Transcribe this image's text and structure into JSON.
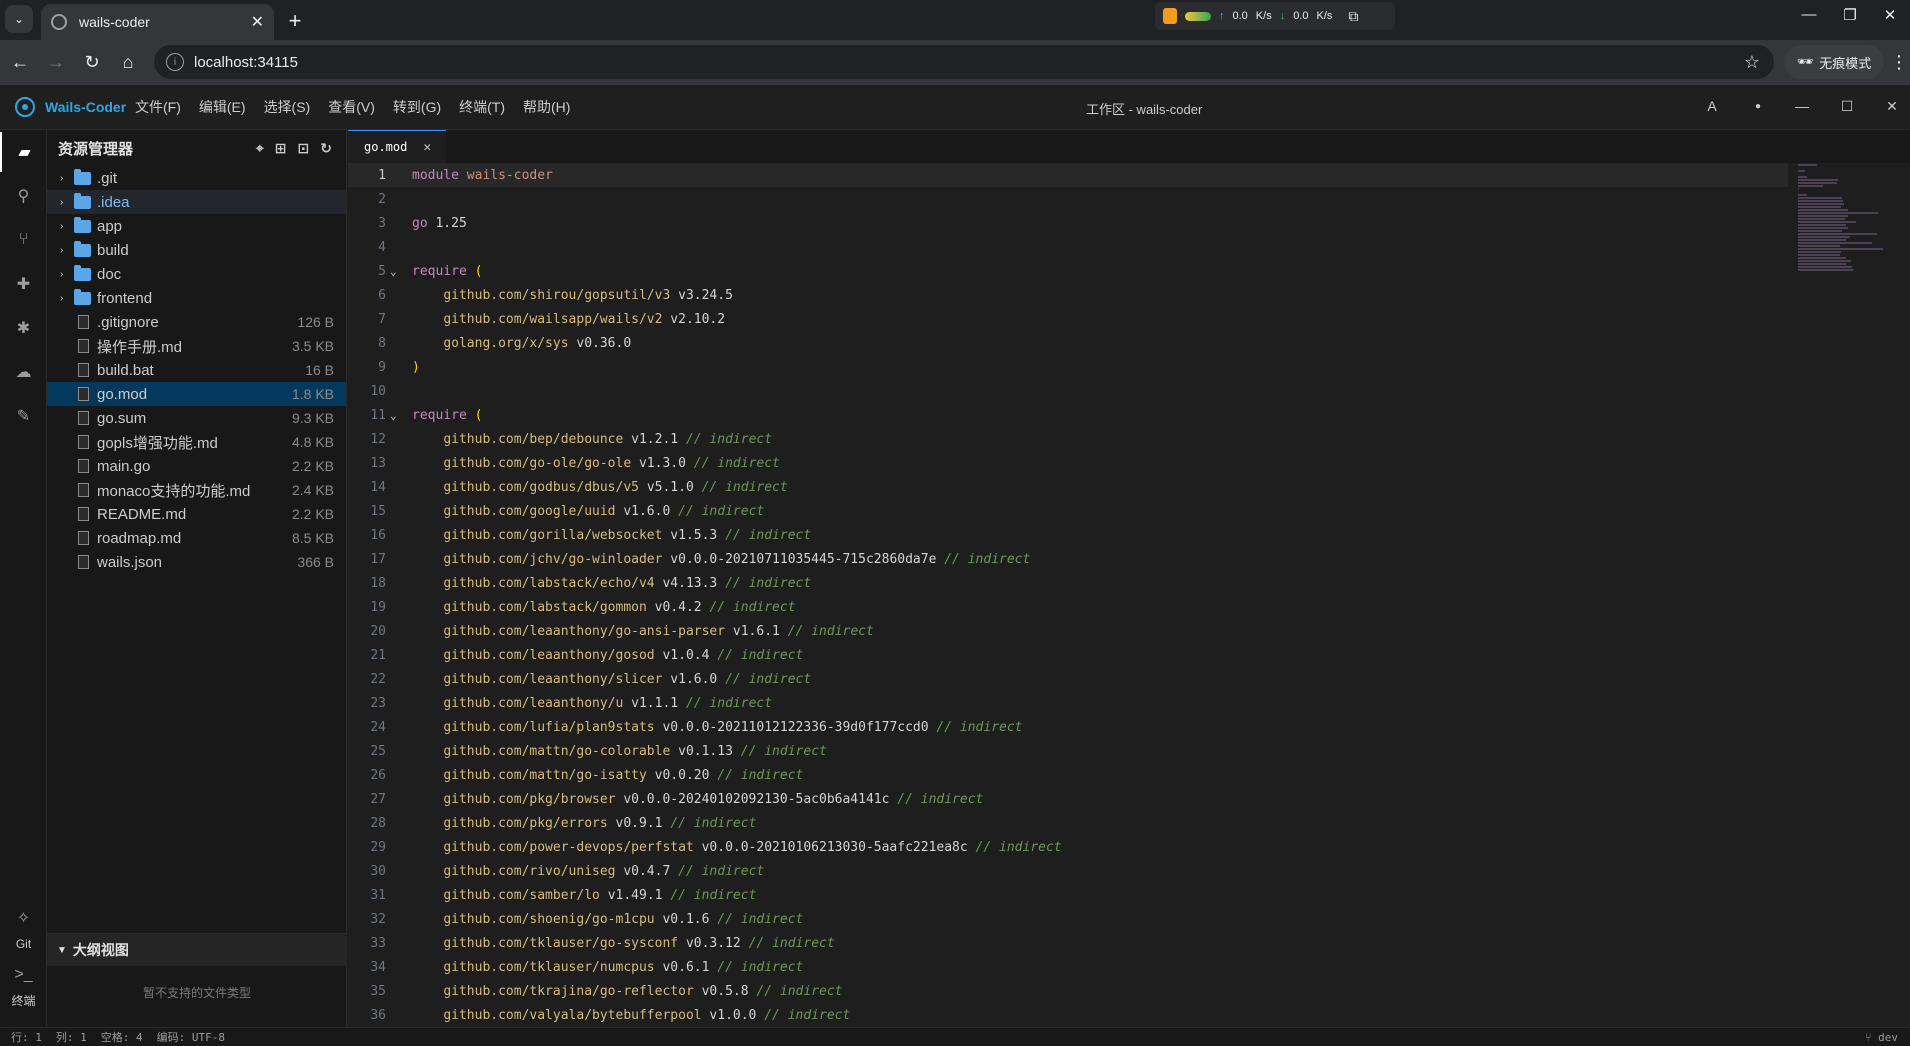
{
  "browser": {
    "tab_title": "wails-coder",
    "url": "localhost:34115",
    "incognito_label": "无痕模式",
    "net_up": "0.0",
    "net_down": "0.0",
    "net_unit": "K/s"
  },
  "app": {
    "title": "Wails-Coder",
    "menus": [
      "文件(F)",
      "编辑(E)",
      "选择(S)",
      "查看(V)",
      "转到(G)",
      "终端(T)",
      "帮助(H)"
    ],
    "workspace_title": "工作区 - wails-coder",
    "font_button": "A"
  },
  "activity": {
    "git_label": "Git",
    "terminal_label": "终端"
  },
  "explorer": {
    "title": "资源管理器",
    "items": [
      {
        "name": ".git",
        "type": "folder",
        "size": ""
      },
      {
        "name": ".idea",
        "type": "folder",
        "size": ""
      },
      {
        "name": "app",
        "type": "folder",
        "size": ""
      },
      {
        "name": "build",
        "type": "folder",
        "size": ""
      },
      {
        "name": "doc",
        "type": "folder",
        "size": ""
      },
      {
        "name": "frontend",
        "type": "folder",
        "size": ""
      },
      {
        "name": ".gitignore",
        "type": "file",
        "size": "126 B"
      },
      {
        "name": "操作手册.md",
        "type": "file",
        "size": "3.5 KB"
      },
      {
        "name": "build.bat",
        "type": "file",
        "size": "16 B"
      },
      {
        "name": "go.mod",
        "type": "file",
        "size": "1.8 KB"
      },
      {
        "name": "go.sum",
        "type": "file",
        "size": "9.3 KB"
      },
      {
        "name": "gopls增强功能.md",
        "type": "file",
        "size": "4.8 KB"
      },
      {
        "name": "main.go",
        "type": "file",
        "size": "2.2 KB"
      },
      {
        "name": "monaco支持的功能.md",
        "type": "file",
        "size": "2.4 KB"
      },
      {
        "name": "README.md",
        "type": "file",
        "size": "2.2 KB"
      },
      {
        "name": "roadmap.md",
        "type": "file",
        "size": "8.5 KB"
      },
      {
        "name": "wails.json",
        "type": "file",
        "size": "366 B"
      }
    ],
    "hovered_index": 1,
    "selected_index": 9
  },
  "outline": {
    "title": "大纲视图",
    "empty_text": "暂不支持的文件类型"
  },
  "editor": {
    "tab": "go.mod",
    "lines": [
      {
        "n": "1",
        "kind": "module",
        "a": "module",
        "b": "wails-coder"
      },
      {
        "n": "2",
        "kind": "blank"
      },
      {
        "n": "3",
        "kind": "go",
        "a": "go",
        "b": "1.25"
      },
      {
        "n": "4",
        "kind": "blank"
      },
      {
        "n": "5",
        "kind": "require",
        "a": "require",
        "b": "("
      },
      {
        "n": "6",
        "kind": "dep",
        "a": "github.com/shirou/gopsutil/v3",
        "b": "v3.24.5",
        "c": ""
      },
      {
        "n": "7",
        "kind": "dep",
        "a": "github.com/wailsapp/wails/v2",
        "b": "v2.10.2",
        "c": ""
      },
      {
        "n": "8",
        "kind": "dep",
        "a": "golang.org/x/sys",
        "b": "v0.36.0",
        "c": ""
      },
      {
        "n": "9",
        "kind": "close",
        "a": ")"
      },
      {
        "n": "10",
        "kind": "blank"
      },
      {
        "n": "11",
        "kind": "require",
        "a": "require",
        "b": "("
      },
      {
        "n": "12",
        "kind": "dep",
        "a": "github.com/bep/debounce",
        "b": "v1.2.1",
        "c": "// indirect"
      },
      {
        "n": "13",
        "kind": "dep",
        "a": "github.com/go-ole/go-ole",
        "b": "v1.3.0",
        "c": "// indirect"
      },
      {
        "n": "14",
        "kind": "dep",
        "a": "github.com/godbus/dbus/v5",
        "b": "v5.1.0",
        "c": "// indirect"
      },
      {
        "n": "15",
        "kind": "dep",
        "a": "github.com/google/uuid",
        "b": "v1.6.0",
        "c": "// indirect"
      },
      {
        "n": "16",
        "kind": "dep",
        "a": "github.com/gorilla/websocket",
        "b": "v1.5.3",
        "c": "// indirect"
      },
      {
        "n": "17",
        "kind": "dep",
        "a": "github.com/jchv/go-winloader",
        "b": "v0.0.0-20210711035445-715c2860da7e",
        "c": "// indirect"
      },
      {
        "n": "18",
        "kind": "dep",
        "a": "github.com/labstack/echo/v4",
        "b": "v4.13.3",
        "c": "// indirect"
      },
      {
        "n": "19",
        "kind": "dep",
        "a": "github.com/labstack/gommon",
        "b": "v0.4.2",
        "c": "// indirect"
      },
      {
        "n": "20",
        "kind": "dep",
        "a": "github.com/leaanthony/go-ansi-parser",
        "b": "v1.6.1",
        "c": "// indirect"
      },
      {
        "n": "21",
        "kind": "dep",
        "a": "github.com/leaanthony/gosod",
        "b": "v1.0.4",
        "c": "// indirect"
      },
      {
        "n": "22",
        "kind": "dep",
        "a": "github.com/leaanthony/slicer",
        "b": "v1.6.0",
        "c": "// indirect"
      },
      {
        "n": "23",
        "kind": "dep",
        "a": "github.com/leaanthony/u",
        "b": "v1.1.1",
        "c": "// indirect"
      },
      {
        "n": "24",
        "kind": "dep",
        "a": "github.com/lufia/plan9stats",
        "b": "v0.0.0-20211012122336-39d0f177ccd0",
        "c": "// indirect"
      },
      {
        "n": "25",
        "kind": "dep",
        "a": "github.com/mattn/go-colorable",
        "b": "v0.1.13",
        "c": "// indirect"
      },
      {
        "n": "26",
        "kind": "dep",
        "a": "github.com/mattn/go-isatty",
        "b": "v0.0.20",
        "c": "// indirect"
      },
      {
        "n": "27",
        "kind": "dep",
        "a": "github.com/pkg/browser",
        "b": "v0.0.0-20240102092130-5ac0b6a4141c",
        "c": "// indirect"
      },
      {
        "n": "28",
        "kind": "dep",
        "a": "github.com/pkg/errors",
        "b": "v0.9.1",
        "c": "// indirect"
      },
      {
        "n": "29",
        "kind": "dep",
        "a": "github.com/power-devops/perfstat",
        "b": "v0.0.0-20210106213030-5aafc221ea8c",
        "c": "// indirect"
      },
      {
        "n": "30",
        "kind": "dep",
        "a": "github.com/rivo/uniseg",
        "b": "v0.4.7",
        "c": "// indirect"
      },
      {
        "n": "31",
        "kind": "dep",
        "a": "github.com/samber/lo",
        "b": "v1.49.1",
        "c": "// indirect"
      },
      {
        "n": "32",
        "kind": "dep",
        "a": "github.com/shoenig/go-m1cpu",
        "b": "v0.1.6",
        "c": "// indirect"
      },
      {
        "n": "33",
        "kind": "dep",
        "a": "github.com/tklauser/go-sysconf",
        "b": "v0.3.12",
        "c": "// indirect"
      },
      {
        "n": "34",
        "kind": "dep",
        "a": "github.com/tklauser/numcpus",
        "b": "v0.6.1",
        "c": "// indirect"
      },
      {
        "n": "35",
        "kind": "dep",
        "a": "github.com/tkrajina/go-reflector",
        "b": "v0.5.8",
        "c": "// indirect"
      },
      {
        "n": "36",
        "kind": "dep",
        "a": "github.com/valyala/bytebufferpool",
        "b": "v1.0.0",
        "c": "// indirect"
      }
    ]
  },
  "status": {
    "row": "行: 1",
    "col": "列: 1",
    "spaces": "空格: 4",
    "encoding": "编码: UTF-8",
    "branch": "dev"
  }
}
